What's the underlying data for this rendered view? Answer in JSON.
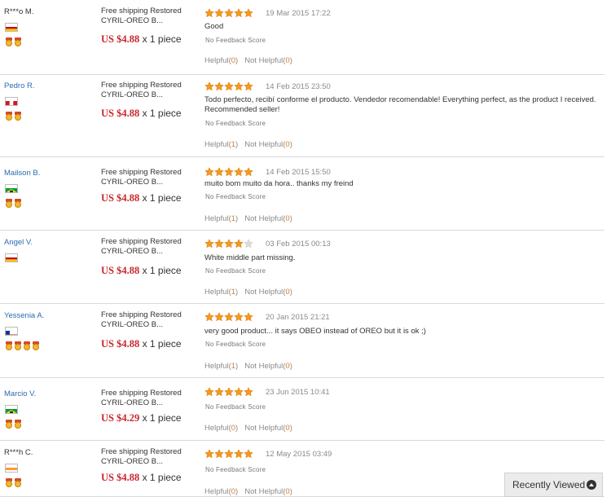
{
  "reviews": [
    {
      "buyer": "R***o M.",
      "buyer_is_link": false,
      "flag": "spain",
      "medals": 2,
      "product": "Free shipping Restored CYRIL-OREO B...",
      "price": "US $4.88",
      "quantity": "x 1 piece",
      "rating": 5,
      "date": "19 Mar 2015 17:22",
      "text": "Good",
      "feedback_score": "No Feedback Score",
      "helpful_label": "Helpful",
      "helpful_count": "0",
      "not_helpful_label": "Not Helpful",
      "not_helpful_count": "0"
    },
    {
      "buyer": "Pedro R.",
      "buyer_is_link": true,
      "flag": "peru",
      "medals": 2,
      "product": "Free shipping Restored CYRIL-OREO B...",
      "price": "US $4.88",
      "quantity": "x 1 piece",
      "rating": 5,
      "date": "14 Feb 2015 23:50",
      "text": "Todo perfecto, recibí conforme el producto. Vendedor recomendable! Everything perfect, as the product I received. Recommended seller!",
      "feedback_score": "No Feedback Score",
      "helpful_label": "Helpful",
      "helpful_count": "1",
      "not_helpful_label": "Not Helpful",
      "not_helpful_count": "0"
    },
    {
      "buyer": "Mailson B.",
      "buyer_is_link": true,
      "flag": "brazil",
      "medals": 2,
      "product": "Free shipping Restored CYRIL-OREO B...",
      "price": "US $4.88",
      "quantity": "x 1 piece",
      "rating": 5,
      "date": "14 Feb 2015 15:50",
      "text": "muito bom muito da hora.. thanks my freind",
      "feedback_score": "No Feedback Score",
      "helpful_label": "Helpful",
      "helpful_count": "1",
      "not_helpful_label": "Not Helpful",
      "not_helpful_count": "0"
    },
    {
      "buyer": "Angel V.",
      "buyer_is_link": true,
      "flag": "spain",
      "medals": 0,
      "product": "Free shipping Restored CYRIL-OREO B...",
      "price": "US $4.88",
      "quantity": "x 1 piece",
      "rating": 4,
      "date": "03 Feb 2015 00:13",
      "text": "White middle part missing.",
      "feedback_score": "No Feedback Score",
      "helpful_label": "Helpful",
      "helpful_count": "1",
      "not_helpful_label": "Not Helpful",
      "not_helpful_count": "0"
    },
    {
      "buyer": "Yessenia A.",
      "buyer_is_link": true,
      "flag": "chile",
      "medals": 4,
      "product": "Free shipping Restored CYRIL-OREO B...",
      "price": "US $4.88",
      "quantity": "x 1 piece",
      "rating": 5,
      "date": "20 Jan 2015 21:21",
      "text": "very good product... it says OBEO instead of OREO but it is ok ;)",
      "feedback_score": "No Feedback Score",
      "helpful_label": "Helpful",
      "helpful_count": "1",
      "not_helpful_label": "Not Helpful",
      "not_helpful_count": "0"
    },
    {
      "buyer": "Marcio V.",
      "buyer_is_link": true,
      "flag": "brazil",
      "medals": 2,
      "product": "Free shipping Restored CYRIL-OREO B...",
      "price": "US $4.29",
      "quantity": "x 1 piece",
      "rating": 5,
      "date": "23 Jun 2015 10:41",
      "text": "",
      "feedback_score": "No Feedback Score",
      "helpful_label": "Helpful",
      "helpful_count": "0",
      "not_helpful_label": "Not Helpful",
      "not_helpful_count": "0"
    },
    {
      "buyer": "R***h C.",
      "buyer_is_link": false,
      "flag": "india",
      "medals": 2,
      "product": "Free shipping Restored CYRIL-OREO B...",
      "price": "US $4.88",
      "quantity": "x 1 piece",
      "rating": 5,
      "date": "12 May 2015 03:49",
      "text": "",
      "feedback_score": "No Feedback Score",
      "helpful_label": "Helpful",
      "helpful_count": "0",
      "not_helpful_label": "Not Helpful",
      "not_helpful_count": "0"
    }
  ],
  "recently_viewed": {
    "label": "Recently Viewed",
    "icon": "chevron-up-circle-icon"
  },
  "colors": {
    "price": "#c8282e",
    "star": "#f39a1e",
    "link": "#2a6bb0",
    "count": "#e07a1f"
  }
}
